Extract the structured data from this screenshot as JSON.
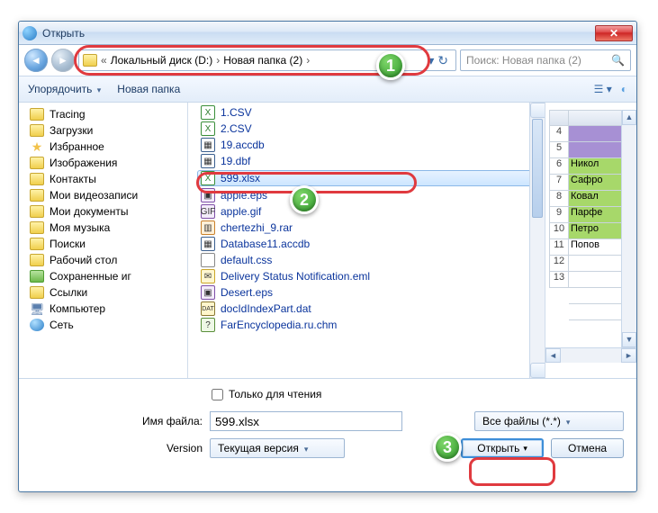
{
  "title": "Открыть",
  "breadcrumb": {
    "pre": "«",
    "p1": "Локальный диск (D:)",
    "p2": "Новая папка (2)"
  },
  "search_placeholder": "Поиск: Новая папка (2)",
  "toolbar": {
    "organize": "Упорядочить",
    "newfolder": "Новая папка"
  },
  "tree": [
    {
      "icon": "foldericon",
      "label": "Tracing"
    },
    {
      "icon": "foldericon",
      "label": "Загрузки"
    },
    {
      "icon": "staricon",
      "label": "Избранное",
      "glyph": "★"
    },
    {
      "icon": "foldericon",
      "label": "Изображения"
    },
    {
      "icon": "foldericon",
      "label": "Контакты"
    },
    {
      "icon": "foldericon",
      "label": "Мои видеозаписи"
    },
    {
      "icon": "foldericon",
      "label": "Мои документы"
    },
    {
      "icon": "foldericon",
      "label": "Моя музыка"
    },
    {
      "icon": "foldericon",
      "label": "Поиски"
    },
    {
      "icon": "foldericon",
      "label": "Рабочий стол"
    },
    {
      "icon": "libicon",
      "label": "Сохраненные иг"
    },
    {
      "icon": "foldericon",
      "label": "Ссылки"
    },
    {
      "icon": "compicon",
      "label": "Компьютер",
      "glyph": "🖥"
    },
    {
      "icon": "neticon",
      "label": "Сеть"
    }
  ],
  "files": [
    {
      "icon": "xls",
      "name": "1.CSV",
      "g": "X"
    },
    {
      "icon": "xls",
      "name": "2.CSV",
      "g": "X"
    },
    {
      "icon": "dbf",
      "name": "19.accdb",
      "g": "▦"
    },
    {
      "icon": "dbf",
      "name": "19.dbf",
      "g": "▦"
    },
    {
      "icon": "xls",
      "name": "599.xlsx",
      "g": "X",
      "selected": true
    },
    {
      "icon": "gif",
      "name": "apple.eps",
      "g": "▣"
    },
    {
      "icon": "gif",
      "name": "apple.gif",
      "g": "GIF"
    },
    {
      "icon": "rar",
      "name": "chertezhi_9.rar",
      "g": "▥"
    },
    {
      "icon": "dbf",
      "name": "Database11.accdb",
      "g": "▦"
    },
    {
      "icon": "css",
      "name": "default.css",
      "g": ""
    },
    {
      "icon": "eml",
      "name": "Delivery Status Notification.eml",
      "g": "✉"
    },
    {
      "icon": "gif",
      "name": "Desert.eps",
      "g": "▣"
    },
    {
      "icon": "dat",
      "name": "docIdIndexPart.dat",
      "g": "DAT"
    },
    {
      "icon": "chm",
      "name": "FarEncyclopedia.ru.chm",
      "g": "?"
    }
  ],
  "readonly_label": "Только для чтения",
  "filename_label": "Имя файла:",
  "filename_value": "599.xlsx",
  "filter_label": "Все файлы (*.*)",
  "version_label": "Version",
  "version_value": "Текущая версия",
  "open_btn": "Открыть",
  "cancel_btn": "Отмена",
  "preview_rows": [
    "4",
    "5",
    "6",
    "7",
    "8",
    "9",
    "10",
    "11",
    "12",
    "13"
  ],
  "preview_data": [
    {
      "cls": "purple",
      "v": ""
    },
    {
      "cls": "purple",
      "v": ""
    },
    {
      "cls": "green",
      "v": "Никол"
    },
    {
      "cls": "green",
      "v": "Сафро"
    },
    {
      "cls": "green",
      "v": "Ковал"
    },
    {
      "cls": "green",
      "v": "Парфе"
    },
    {
      "cls": "green",
      "v": "Петро"
    },
    {
      "cls": "",
      "v": "Попов"
    },
    {
      "cls": "",
      "v": ""
    },
    {
      "cls": "",
      "v": ""
    },
    {
      "cls": "",
      "v": ""
    },
    {
      "cls": "",
      "v": ""
    }
  ],
  "badges": {
    "a": "1",
    "b": "2",
    "c": "3"
  }
}
